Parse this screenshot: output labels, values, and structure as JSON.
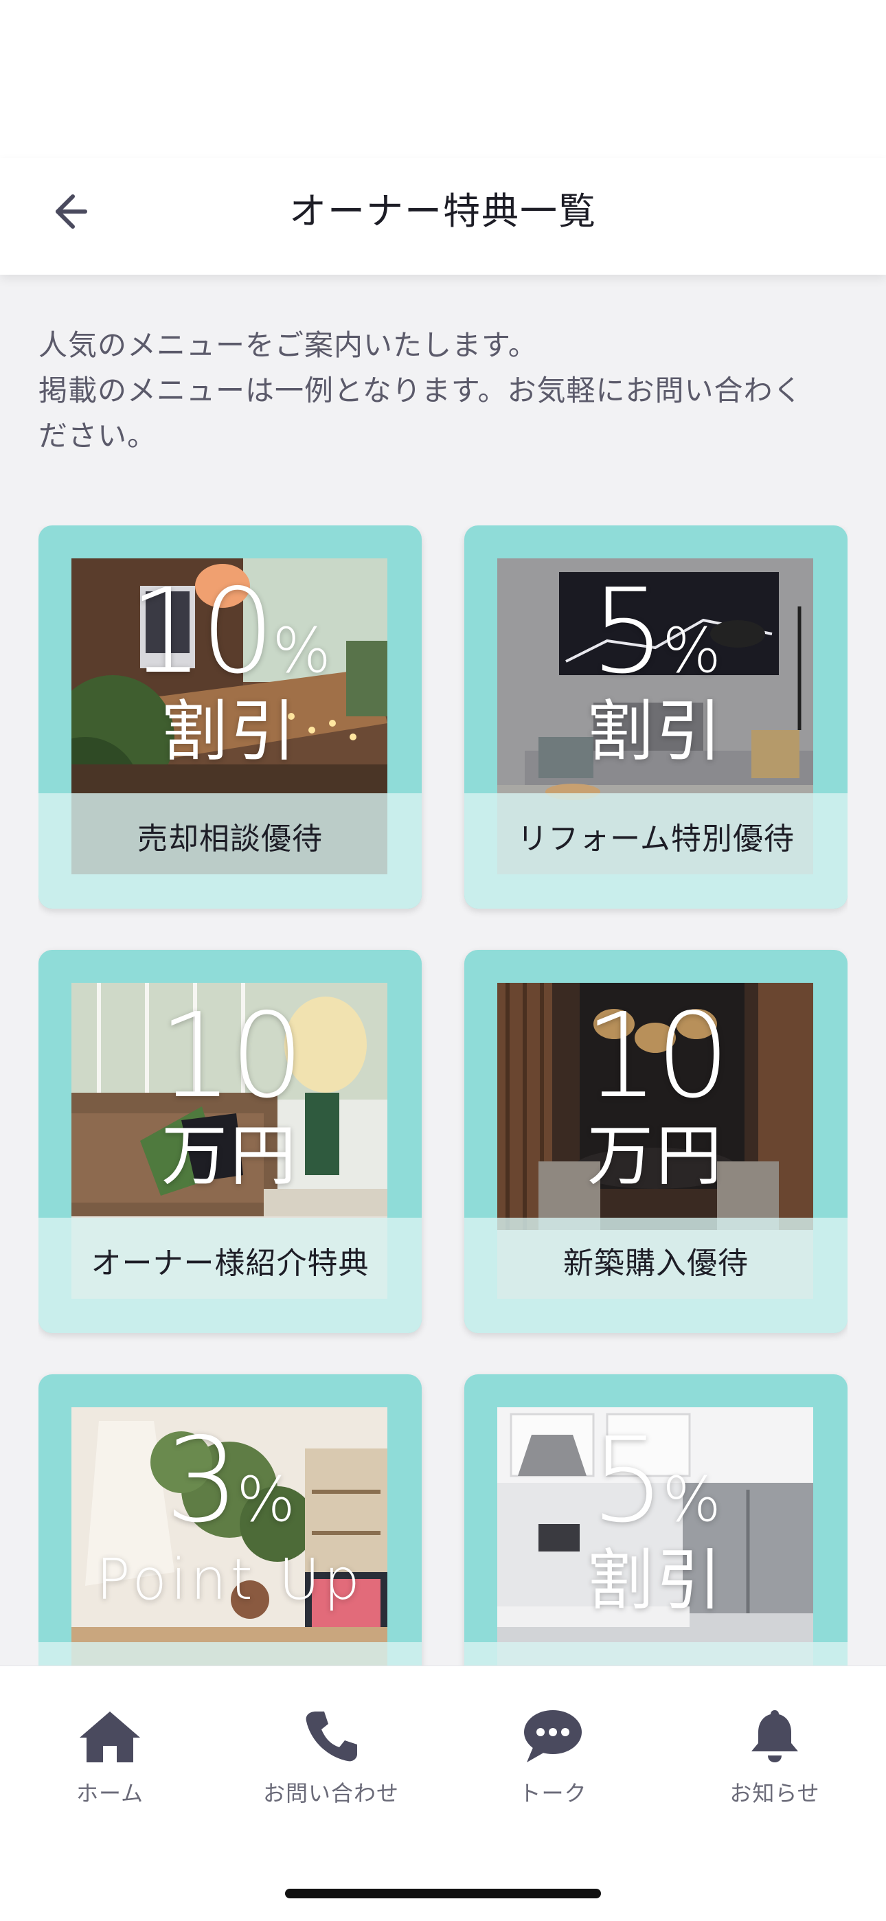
{
  "header": {
    "title": "オーナー特典一覧"
  },
  "intro": {
    "line1": "人気のメニューをご案内いたします。",
    "line2": "掲載のメニューは一例となります。お気軽にお問い合わく",
    "line3": "ださい。"
  },
  "cards": [
    {
      "big": "10",
      "unit": "%",
      "sub": "割引",
      "caption": "売却相談優待"
    },
    {
      "big": "5",
      "unit": "%",
      "sub": "割引",
      "caption": "リフォーム特別優待"
    },
    {
      "big": "10",
      "unit": "",
      "sub": "万円",
      "caption": "オーナー様紹介特典"
    },
    {
      "big": "10",
      "unit": "",
      "sub": "万円",
      "caption": "新築購入優待"
    },
    {
      "big": "3",
      "unit": "%",
      "sub": "Point Up",
      "caption": ""
    },
    {
      "big": "5",
      "unit": "%",
      "sub": "割引",
      "caption": ""
    }
  ],
  "tabbar": {
    "home": "ホーム",
    "contact": "お問い合わせ",
    "talk": "トーク",
    "news": "お知らせ"
  },
  "colors": {
    "card_frame": "#8fdcd8",
    "icon": "#4a4a5e"
  }
}
